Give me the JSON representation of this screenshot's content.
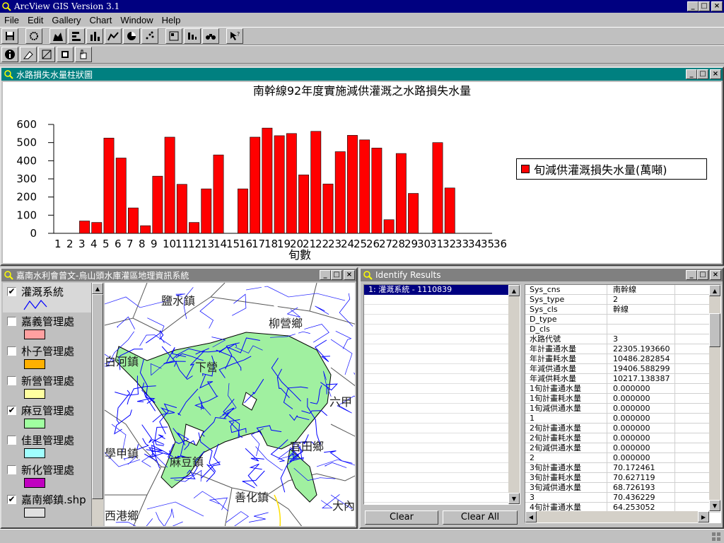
{
  "app": {
    "title": "ArcView GIS Version 3.1",
    "menu": [
      "File",
      "Edit",
      "Gallery",
      "Chart",
      "Window",
      "Help"
    ],
    "buttons": {
      "minimize": "_",
      "maximize": "□",
      "close": "×"
    }
  },
  "chart_window": {
    "title": "水路損失水量柱狀圖"
  },
  "chart_data": {
    "type": "bar",
    "title": "南幹線92年度實施減供灌溉之水路損失水量",
    "xlabel": "旬數",
    "ylabel": "",
    "ylim": [
      0,
      600
    ],
    "yticks": [
      0,
      100,
      200,
      300,
      400,
      500,
      600
    ],
    "categories": [
      "1",
      "2",
      "3",
      "4",
      "5",
      "6",
      "7",
      "8",
      "9",
      "10",
      "11",
      "12",
      "13",
      "14",
      "15",
      "16",
      "17",
      "18",
      "19",
      "20",
      "21",
      "22",
      "23",
      "24",
      "25",
      "26",
      "27",
      "28",
      "29",
      "30",
      "31",
      "32",
      "33",
      "34",
      "35",
      "36"
    ],
    "series": [
      {
        "name": "旬減供灌溉損失水量(萬噸)",
        "color": "#ff0000",
        "values": [
          0,
          0,
          68,
          60,
          525,
          415,
          140,
          42,
          315,
          530,
          270,
          60,
          245,
          432,
          0,
          245,
          530,
          580,
          538,
          550,
          322,
          562,
          272,
          450,
          540,
          515,
          470,
          75,
          440,
          220,
          0,
          500,
          250,
          0,
          0,
          0
        ]
      }
    ],
    "legend_position": "right",
    "grid": false
  },
  "map_window": {
    "title": "嘉南水利會曾文-烏山頭水庫灌區地理資訊系統",
    "layers": [
      {
        "label": "灌溉系統",
        "checked": true,
        "swatch": "line",
        "color": "#0000ff"
      },
      {
        "label": "嘉義管理處",
        "checked": false,
        "swatch": "fill",
        "color": "#ffa0a0"
      },
      {
        "label": "朴子管理處",
        "checked": false,
        "swatch": "fill",
        "color": "#ffb000"
      },
      {
        "label": "新營管理處",
        "checked": false,
        "swatch": "fill",
        "color": "#ffffa0"
      },
      {
        "label": "麻豆管理處",
        "checked": true,
        "swatch": "fill",
        "color": "#a0ffa0"
      },
      {
        "label": "佳里管理處",
        "checked": false,
        "swatch": "fill",
        "color": "#a0ffff"
      },
      {
        "label": "新化管理處",
        "checked": false,
        "swatch": "fill",
        "color": "#c000c0"
      },
      {
        "label": "嘉南鄉鎮.shp",
        "checked": true,
        "swatch": "fill",
        "color": "#e0e0e0"
      }
    ],
    "place_labels": [
      {
        "text": "鹽水鎮"
      },
      {
        "text": "柳營鄉"
      },
      {
        "text": "白河鎮"
      },
      {
        "text": "六甲"
      },
      {
        "text": "官田鄉"
      },
      {
        "text": "學甲鎮"
      },
      {
        "text": "麻豆鎮"
      },
      {
        "text": "善化鎮"
      },
      {
        "text": "西港鄉"
      },
      {
        "text": "大內"
      },
      {
        "text": "下營"
      }
    ]
  },
  "identify_window": {
    "title": "Identify Results",
    "selected_item": "1: 灌溉系統 - 1110839",
    "clear_label": "Clear",
    "clear_all_label": "Clear All",
    "attributes": [
      {
        "field": "Sys_cns",
        "value": "南幹線"
      },
      {
        "field": "Sys_type",
        "value": "2"
      },
      {
        "field": "Sys_cls",
        "value": "幹線"
      },
      {
        "field": "D_type",
        "value": ""
      },
      {
        "field": "D_cls",
        "value": ""
      },
      {
        "field": "水路代號",
        "value": "3"
      },
      {
        "field": "年計畫通水量",
        "value": "22305.193660"
      },
      {
        "field": "年計畫耗水量",
        "value": "10486.282854"
      },
      {
        "field": "年減供通水量",
        "value": "19406.588299"
      },
      {
        "field": "年減供耗水量",
        "value": "10217.138387"
      },
      {
        "field": "1旬計畫通水量",
        "value": "0.000000"
      },
      {
        "field": "1旬計畫耗水量",
        "value": "0.000000"
      },
      {
        "field": "1旬減供通水量",
        "value": "0.000000"
      },
      {
        "field": "1",
        "value": "0.000000"
      },
      {
        "field": "2旬計畫通水量",
        "value": "0.000000"
      },
      {
        "field": "2旬計畫耗水量",
        "value": "0.000000"
      },
      {
        "field": "2旬減供通水量",
        "value": "0.000000"
      },
      {
        "field": "2",
        "value": "0.000000"
      },
      {
        "field": "3旬計畫通水量",
        "value": "70.172461"
      },
      {
        "field": "3旬計畫耗水量",
        "value": "70.627119"
      },
      {
        "field": "3旬減供通水量",
        "value": "68.726193"
      },
      {
        "field": "3",
        "value": "70.436229"
      },
      {
        "field": "4旬計畫通水量",
        "value": "64.253052"
      }
    ]
  }
}
